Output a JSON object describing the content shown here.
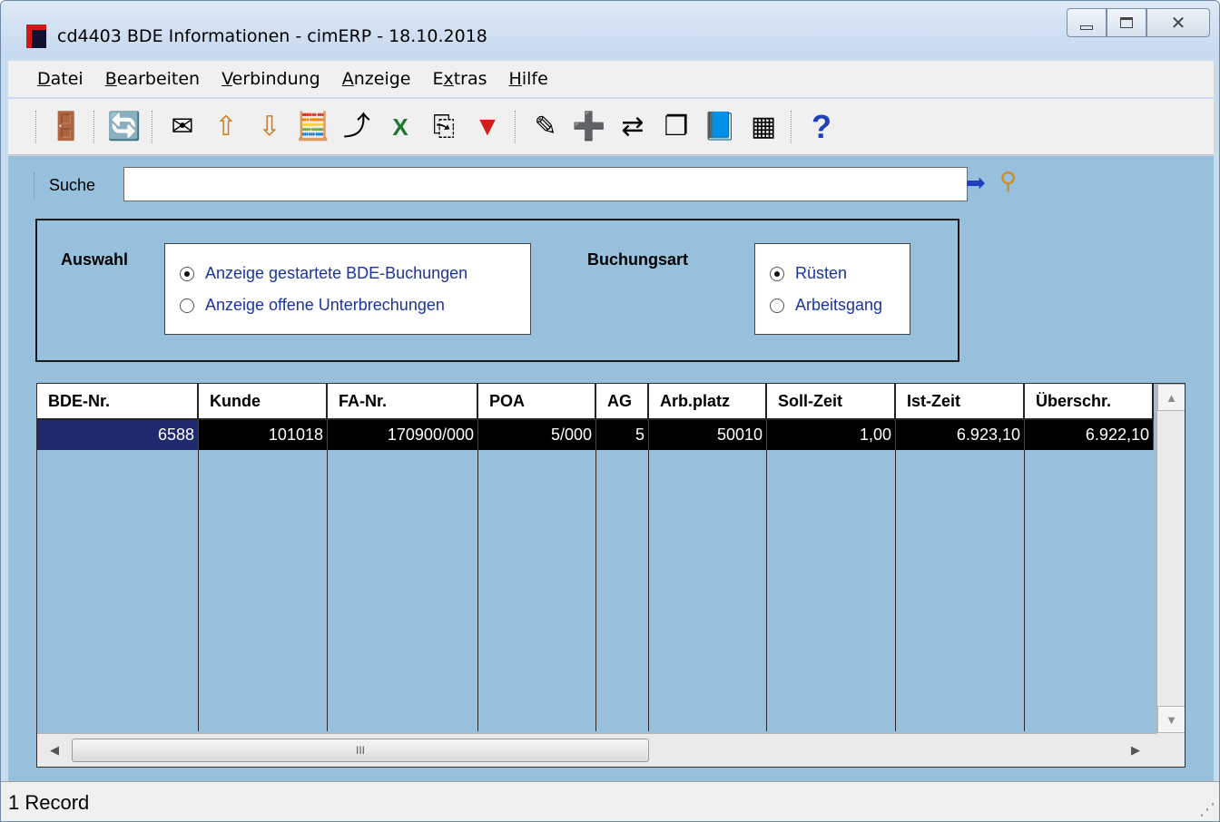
{
  "window": {
    "title": "cd4403 BDE Informationen - cimERP - 18.10.2018"
  },
  "menu": [
    {
      "pre": "",
      "ul": "D",
      "post": "atei"
    },
    {
      "pre": "",
      "ul": "B",
      "post": "earbeiten"
    },
    {
      "pre": "",
      "ul": "V",
      "post": "erbindung"
    },
    {
      "pre": "",
      "ul": "A",
      "post": "nzeige"
    },
    {
      "pre": "E",
      "ul": "x",
      "post": "tras"
    },
    {
      "pre": "",
      "ul": "H",
      "post": "ilfe"
    }
  ],
  "toolbar": {
    "icons": [
      "exit-icon",
      "refresh-icon",
      "mail-icon",
      "sort-ascending-icon",
      "sort-descending-icon",
      "calculator-icon",
      "export-icon",
      "excel-icon",
      "copy-icon",
      "filter-icon",
      "edit-icon",
      "new-record-icon",
      "transfer-icon",
      "windows-icon",
      "book-icon",
      "grid-icon",
      "help-icon"
    ],
    "glyphs": [
      "🚪",
      "🔄",
      "✉",
      "⇧",
      "⇩",
      "🧮",
      "⤴",
      "X",
      "⎘",
      "▼",
      "✎",
      "➕",
      "⇄",
      "❐",
      "📘",
      "▦",
      "?"
    ]
  },
  "search": {
    "label": "Suche",
    "value": ""
  },
  "filter": {
    "auswahl_label": "Auswahl",
    "auswahl_options": [
      "Anzeige gestartete BDE-Buchungen",
      "Anzeige offene Unterbrechungen"
    ],
    "auswahl_selected": 0,
    "buchungsart_label": "Buchungsart",
    "buchungsart_options": [
      "Rüsten",
      "Arbeitsgang"
    ],
    "buchungsart_selected": 0
  },
  "table": {
    "columns": [
      "BDE-Nr.",
      "Kunde",
      "FA-Nr.",
      "POA",
      "AG",
      "Arb.platz",
      "Soll-Zeit",
      "Ist-Zeit",
      "Überschr."
    ],
    "rows": [
      [
        "6588",
        "101018",
        "170900/000",
        "5/000",
        "5",
        "50010",
        "1,00",
        "6.923,10",
        "6.922,10"
      ]
    ]
  },
  "hscroll_thumb_glyph": "III",
  "status": {
    "text": "1 Record"
  },
  "colors": {
    "background": "#96c0dc",
    "selected_row": "#000000",
    "first_cell": "#1f2a6e",
    "radio_text": "#1a35a0"
  }
}
